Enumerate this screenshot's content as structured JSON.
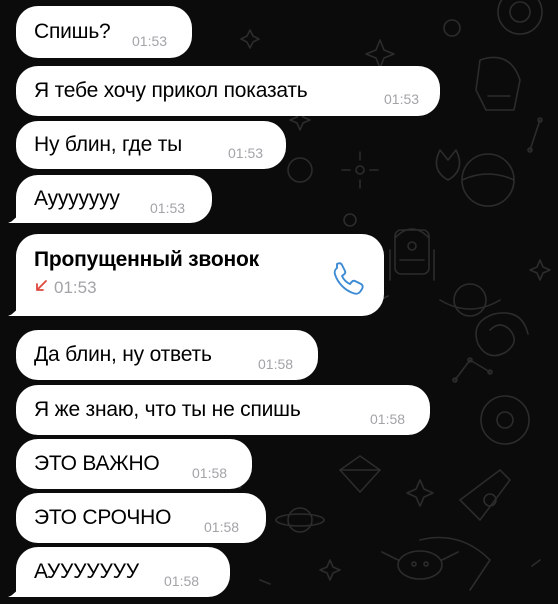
{
  "messages": [
    {
      "text": "Спишь?",
      "time": "01:53"
    },
    {
      "text": "Я тебе хочу прикол показать",
      "time": "01:53"
    },
    {
      "text": "Ну блин, где ты",
      "time": "01:53"
    },
    {
      "text": "Аууууууу",
      "time": "01:53"
    },
    {
      "text": "Да блин, ну ответь",
      "time": "01:58"
    },
    {
      "text": "Я же знаю, что ты не спишь",
      "time": "01:58"
    },
    {
      "text": "ЭТО ВАЖНО",
      "time": "01:58"
    },
    {
      "text": "ЭТО СРОЧНО",
      "time": "01:58"
    },
    {
      "text": "АУУУУУУУ",
      "time": "01:58"
    }
  ],
  "missed_call": {
    "title": "Пропущенный звонок",
    "time": "01:53",
    "arrow_icon": "missed-call-arrow-icon",
    "phone_icon": "phone-icon"
  },
  "colors": {
    "bubble": "#ffffff",
    "timestamp": "#a3a3a8",
    "missed_call_arrow": "#e0473c",
    "phone_icon": "#3d8bd4",
    "background": "#0b0b0b",
    "wallpaper_pattern": "#2a2a2a"
  }
}
